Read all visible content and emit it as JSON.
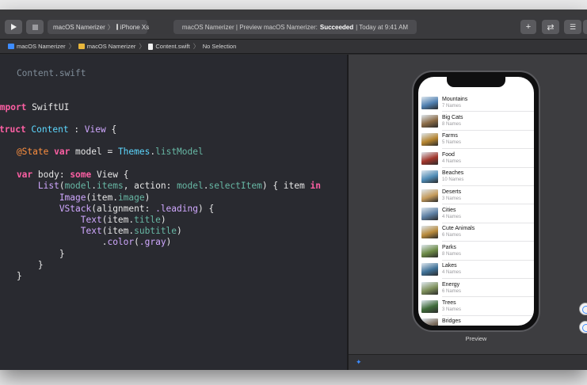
{
  "toolbar": {
    "run_icon": "play-icon",
    "stop_icon": "stop-square-icon",
    "scheme": {
      "app": "macOS Namerizer",
      "device": "iPhone Xs"
    },
    "status": {
      "prefix": "macOS Namerizer | Preview macOS Namerizer:",
      "result": "Succeeded",
      "suffix": "| Today at 9:41 AM"
    },
    "right_buttons": [
      {
        "icon": "plus-icon",
        "label": "+"
      },
      {
        "icon": "swap-arrows-icon",
        "label": "⇄"
      },
      {
        "icon": "layout-toggle-icon",
        "label": "☰"
      },
      {
        "icon": "sidebar-toggle-icon",
        "label": "▭"
      }
    ]
  },
  "jumpbar": {
    "crumbs": [
      "macOS Namerizer",
      "macOS Namerizer",
      "Content.swift",
      "No Selection"
    ],
    "colors": {
      "project": "#3d8cff",
      "folder": "#e8b63b",
      "file": "#ffffff"
    }
  },
  "editor": {
    "comment_1": "/",
    "comment_2": "/   Content.swift",
    "comment_3": "/",
    "import_kw": "import",
    "import_mod": " SwiftUI",
    "struct_kw": "truct",
    "struct_name": " Content",
    "struct_colon": " : ",
    "struct_proto": "View",
    "struct_brace": " {",
    "state_attr": "    @State",
    "state_var": " var",
    "state_rest_1": " model = ",
    "state_themes": "Themes",
    "state_dot": ".",
    "state_list": "listModel",
    "body_var": "    var",
    "body_name": " body: ",
    "body_some": "some",
    "body_view": " View",
    "body_brace": " {",
    "list_call": "        List",
    "list_open": "(",
    "list_model": "model",
    "list_dot": ".",
    "list_items": "items",
    "list_sep": ", action: ",
    "list_model2": "model",
    "list_dot2": ".",
    "list_select": "selectItem",
    "list_close": ") { item ",
    "list_in": "in",
    "image_call": "            Image",
    "image_args": "(item.",
    "image_prop": "image",
    "image_close": ")",
    "vstack_call": "            VStack",
    "vstack_args": "(alignment: ",
    "vstack_lead": ".leading",
    "vstack_close": ") {",
    "text1_call": "                Text",
    "text1_args": "(item.",
    "text1_prop": "title",
    "text1_close": ")",
    "text2_call": "                Text",
    "text2_args": "(item.",
    "text2_prop": "subtitle",
    "text2_close": ")",
    "color_dot": "                    .",
    "color_fn": "color",
    "color_open": "(",
    "color_gray": ".gray",
    "color_close": ")",
    "close_1": "            }",
    "close_2": "        }",
    "close_3": "    }",
    "close_4": "-"
  },
  "preview": {
    "label": "Preview",
    "items": [
      {
        "title": "Mountains",
        "subtitle": "7 Names",
        "color": "#4f7fb0"
      },
      {
        "title": "Big Cats",
        "subtitle": "8 Names",
        "color": "#8a6a45"
      },
      {
        "title": "Farms",
        "subtitle": "5 Names",
        "color": "#b5842f"
      },
      {
        "title": "Food",
        "subtitle": "4 Names",
        "color": "#a1362c"
      },
      {
        "title": "Beaches",
        "subtitle": "10 Names",
        "color": "#4e8bb5"
      },
      {
        "title": "Deserts",
        "subtitle": "3 Names",
        "color": "#c49a5a"
      },
      {
        "title": "Cities",
        "subtitle": "4 Names",
        "color": "#5d7fa3"
      },
      {
        "title": "Cute Animals",
        "subtitle": "6 Names",
        "color": "#b88a3c"
      },
      {
        "title": "Parks",
        "subtitle": "8 Names",
        "color": "#6c8a46"
      },
      {
        "title": "Lakes",
        "subtitle": "4 Names",
        "color": "#3f7197"
      },
      {
        "title": "Energy",
        "subtitle": "6 Names",
        "color": "#7d8f5a"
      },
      {
        "title": "Trees",
        "subtitle": "3 Names",
        "color": "#3f6b3a"
      },
      {
        "title": "Bridges",
        "subtitle": "4 Names",
        "color": "#7a6a5a"
      }
    ]
  }
}
